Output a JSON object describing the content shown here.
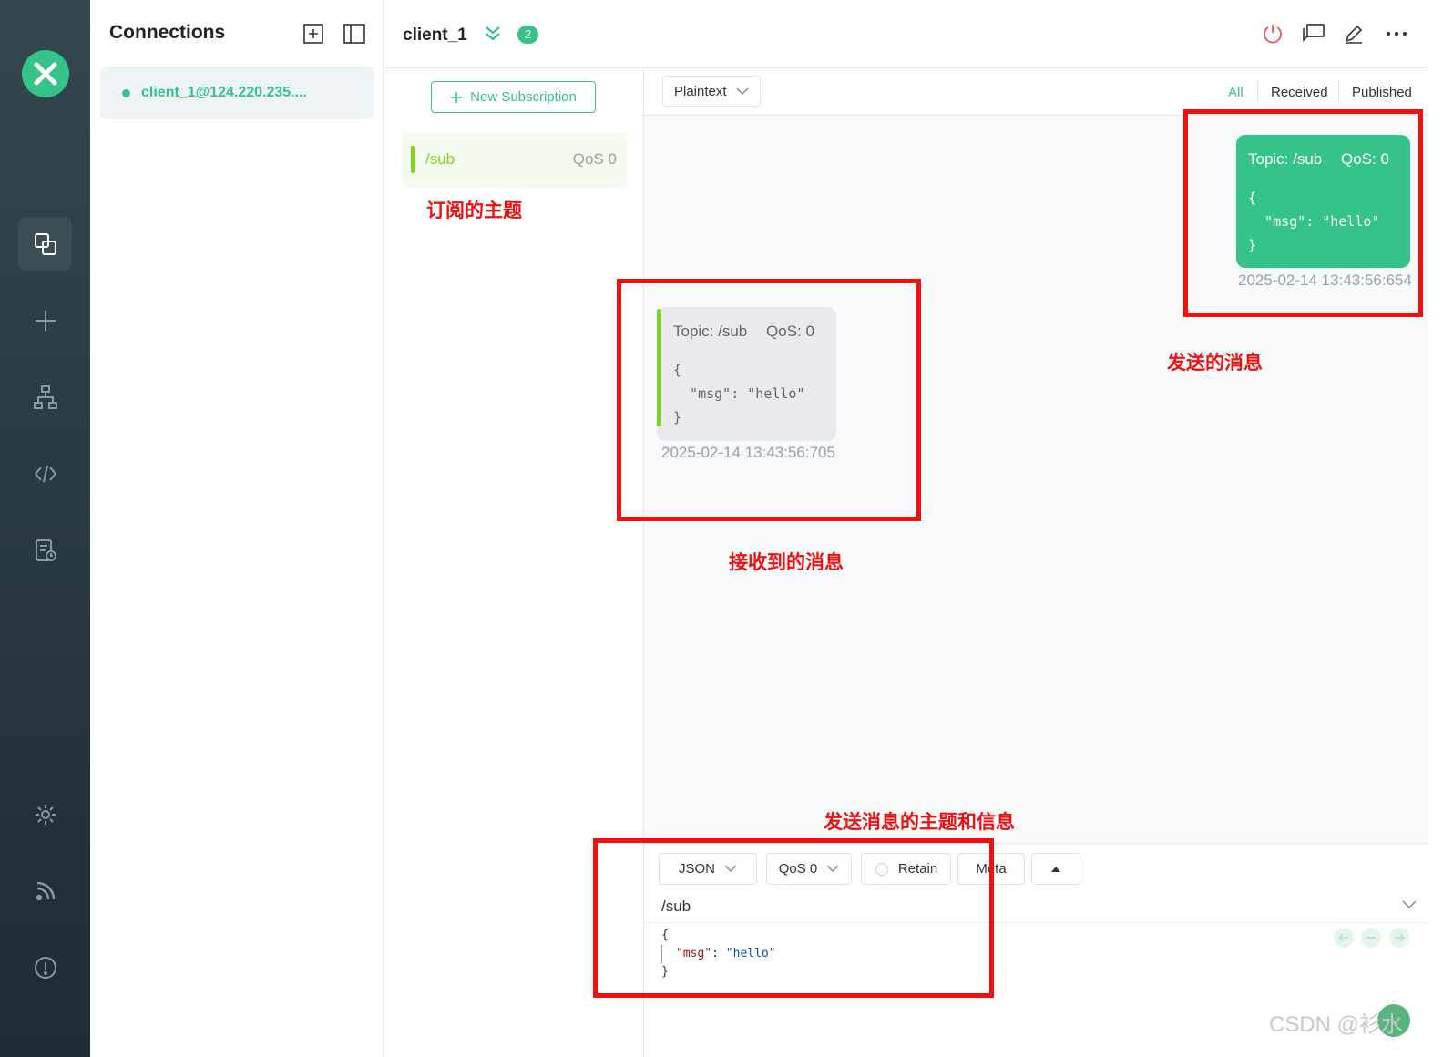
{
  "rail": {
    "logo": "mqttx-logo",
    "icons": [
      "connections-icon",
      "plus-icon",
      "topology-icon",
      "code-icon",
      "log-icon",
      "settings-icon",
      "feed-icon",
      "info-icon"
    ]
  },
  "connections": {
    "title": "Connections",
    "items": [
      {
        "name": "client_1@124.220.235....",
        "status": "connected"
      }
    ]
  },
  "topbar": {
    "title": "client_1",
    "badge": "2"
  },
  "subscriptions": {
    "new_label": "New Subscription",
    "items": [
      {
        "topic": "/sub",
        "qos": "QoS 0",
        "color": "#7ed321"
      }
    ]
  },
  "messages": {
    "format": "Plaintext",
    "filters": [
      "All",
      "Received",
      "Published"
    ],
    "active_filter": "All",
    "sent": {
      "topic": "Topic: /sub",
      "qos": "QoS: 0",
      "payload": "{\n  \"msg\": \"hello\"\n}",
      "time": "2025-02-14 13:43:56:654"
    },
    "received": {
      "topic": "Topic: /sub",
      "qos": "QoS: 0",
      "payload": "{\n  \"msg\": \"hello\"\n}",
      "time": "2025-02-14 13:43:56:705"
    }
  },
  "publish": {
    "format": "JSON",
    "qos": "QoS 0",
    "retain": "Retain",
    "meta": "Meta",
    "topic": "/sub",
    "code_open": "{",
    "code_key": "\"msg\"",
    "code_colon": ": ",
    "code_value": "\"hello\"",
    "code_close": "}"
  },
  "annotations": {
    "subscribed_topic": "订阅的主题",
    "sent_message": "发送的消息",
    "received_message": "接收到的消息",
    "publish_topic_info": "发送消息的主题和信息"
  },
  "watermark": "CSDN @衫水",
  "colors": {
    "accent": "#34c388",
    "sub_color": "#7ed321",
    "annotation": "#f01010",
    "rail": "#2a3a44"
  }
}
